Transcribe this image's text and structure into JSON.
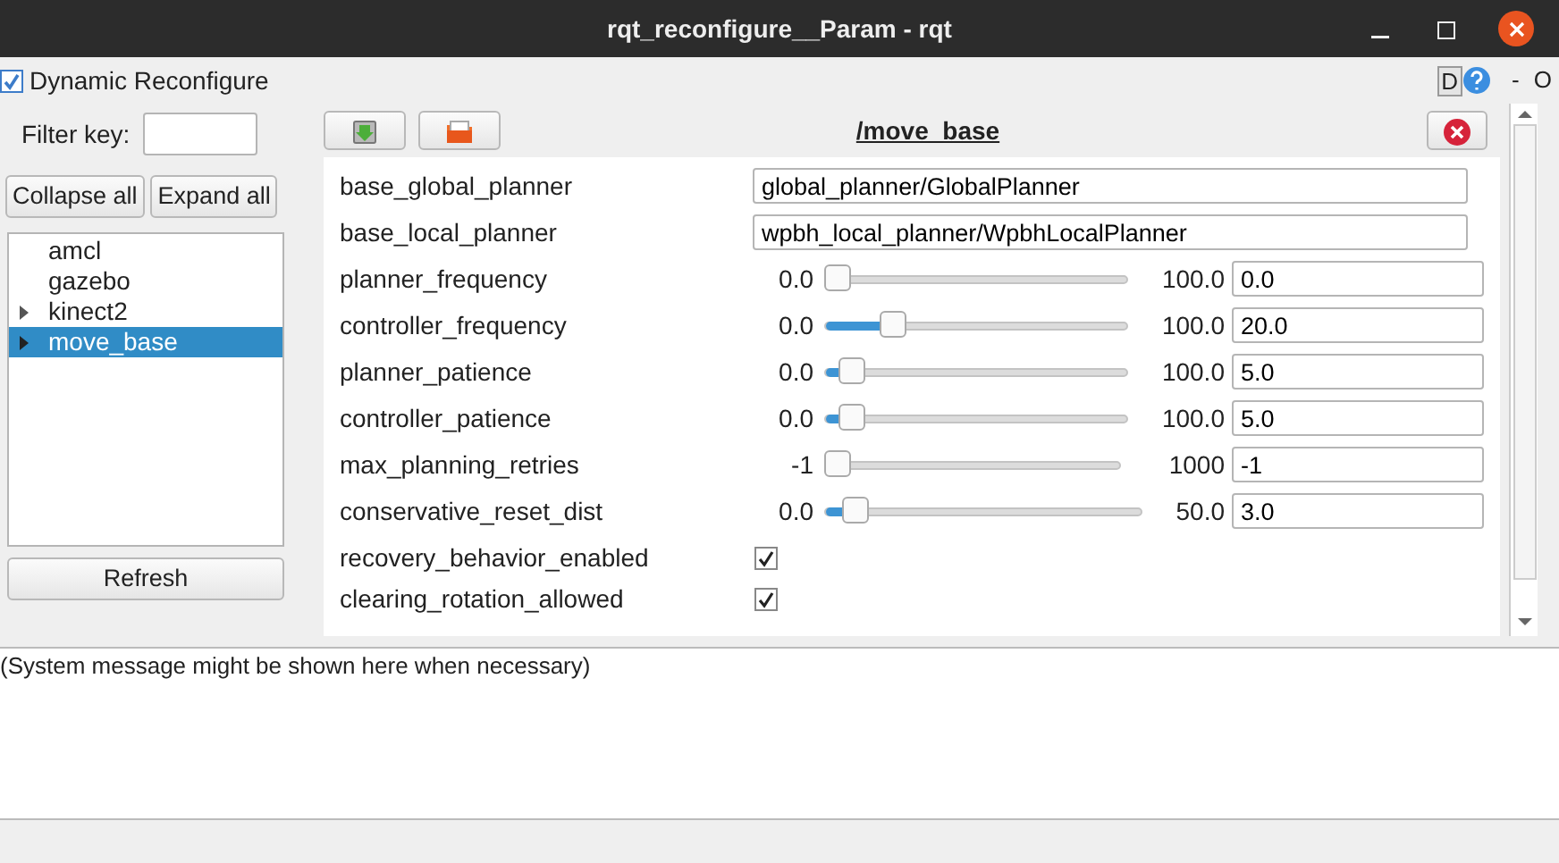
{
  "window": {
    "title": "rqt_reconfigure__Param - rqt"
  },
  "plugin": {
    "title": "Dynamic Reconfigure",
    "checked": true,
    "buttons": [
      "D",
      "-",
      "O"
    ]
  },
  "sidebar": {
    "filter_label": "Filter key:",
    "collapse": "Collapse all",
    "expand": "Expand all",
    "refresh": "Refresh",
    "items": [
      {
        "label": "amcl",
        "has_children": false,
        "selected": false
      },
      {
        "label": "gazebo",
        "has_children": false,
        "selected": false
      },
      {
        "label": "kinect2",
        "has_children": true,
        "selected": false
      },
      {
        "label": "move_base",
        "has_children": true,
        "selected": true
      }
    ]
  },
  "node": {
    "title": "/move_base",
    "params": [
      {
        "kind": "text",
        "name": "base_global_planner",
        "value": "global_planner/GlobalPlanner"
      },
      {
        "kind": "text",
        "name": "base_local_planner",
        "value": "wpbh_local_planner/WpbhLocalPlanner"
      },
      {
        "kind": "slider",
        "name": "planner_frequency",
        "min": "0.0",
        "max": "100.0",
        "value": "0.0",
        "level": 0
      },
      {
        "kind": "slider",
        "name": "controller_frequency",
        "min": "0.0",
        "max": "100.0",
        "value": "20.0",
        "level": 0.2
      },
      {
        "kind": "slider",
        "name": "planner_patience",
        "min": "0.0",
        "max": "100.0",
        "value": "5.0",
        "level": 0.05
      },
      {
        "kind": "slider",
        "name": "controller_patience",
        "min": "0.0",
        "max": "100.0",
        "value": "5.0",
        "level": 0.05
      },
      {
        "kind": "slider",
        "name": "max_planning_retries",
        "min": "-1",
        "max": "1000",
        "value": "-1",
        "level": 0
      },
      {
        "kind": "slider",
        "name": "conservative_reset_dist",
        "min": "0.0",
        "max": "50.0",
        "value": "3.0",
        "level": 0.06
      },
      {
        "kind": "checkbox",
        "name": "recovery_behavior_enabled",
        "checked": true
      },
      {
        "kind": "checkbox",
        "name": "clearing_rotation_allowed",
        "checked": true
      }
    ]
  },
  "message": "(System message might be shown here when necessary)"
}
